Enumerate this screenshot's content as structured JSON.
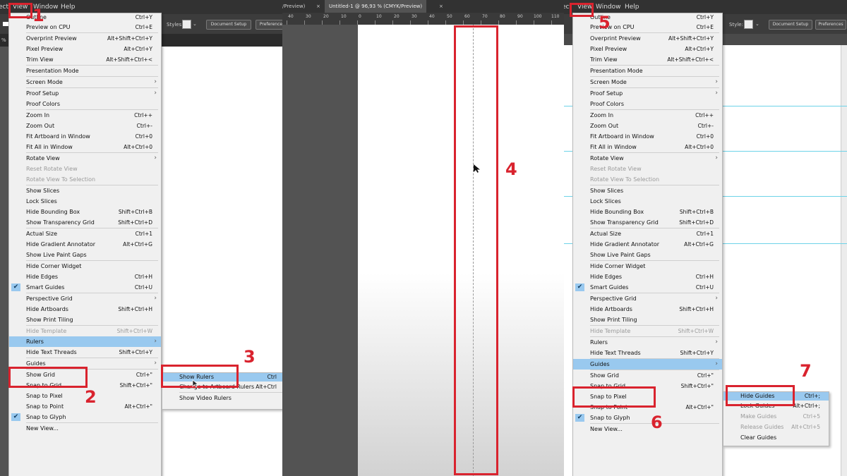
{
  "panel1": {
    "menubar": [
      "ect",
      "View",
      "Window",
      "Help"
    ],
    "control": {
      "styles_label": "Styles:",
      "document_setup": "Document Setup",
      "preferences": "Preference"
    },
    "tab_fragment": "%",
    "view_menu": [
      {
        "label": "Outline",
        "shortcut": "Ctrl+Y"
      },
      {
        "label": "Preview on CPU",
        "shortcut": "Ctrl+E"
      },
      "sep",
      {
        "label": "Overprint Preview",
        "shortcut": "Alt+Shift+Ctrl+Y"
      },
      {
        "label": "Pixel Preview",
        "shortcut": "Alt+Ctrl+Y"
      },
      {
        "label": "Trim View",
        "shortcut": "Alt+Shift+Ctrl+<"
      },
      "sep",
      {
        "label": "Presentation Mode"
      },
      "sep",
      {
        "label": "Screen Mode",
        "submenu": true
      },
      "sep",
      {
        "label": "Proof Setup",
        "submenu": true
      },
      {
        "label": "Proof Colors"
      },
      "sep",
      {
        "label": "Zoom In",
        "shortcut": "Ctrl++"
      },
      {
        "label": "Zoom Out",
        "shortcut": "Ctrl+-"
      },
      {
        "label": "Fit Artboard in Window",
        "shortcut": "Ctrl+0"
      },
      {
        "label": "Fit All in Window",
        "shortcut": "Alt+Ctrl+0"
      },
      "sep",
      {
        "label": "Rotate View",
        "submenu": true
      },
      {
        "label": "Reset Rotate View",
        "disabled": true
      },
      {
        "label": "Rotate View To Selection",
        "disabled": true
      },
      "sep",
      {
        "label": "Show Slices"
      },
      {
        "label": "Lock Slices"
      },
      {
        "label": "Hide Bounding Box",
        "shortcut": "Shift+Ctrl+B"
      },
      {
        "label": "Show Transparency Grid",
        "shortcut": "Shift+Ctrl+D"
      },
      "sep",
      {
        "label": "Actual Size",
        "shortcut": "Ctrl+1"
      },
      {
        "label": "Hide Gradient Annotator",
        "shortcut": "Alt+Ctrl+G"
      },
      {
        "label": "Show Live Paint Gaps"
      },
      "sep",
      {
        "label": "Hide Corner Widget"
      },
      {
        "label": "Hide Edges",
        "shortcut": "Ctrl+H"
      },
      {
        "label": "Smart Guides",
        "shortcut": "Ctrl+U",
        "checked": true
      },
      "sep",
      {
        "label": "Perspective Grid",
        "submenu": true
      },
      {
        "label": "Hide Artboards",
        "shortcut": "Shift+Ctrl+H"
      },
      {
        "label": "Show Print Tiling"
      },
      "sep",
      {
        "label": "Hide Template",
        "shortcut": "Shift+Ctrl+W",
        "disabled": true
      },
      {
        "label": "Rulers",
        "submenu": true,
        "highlighted": true
      },
      {
        "label": "Hide Text Threads",
        "shortcut": "Shift+Ctrl+Y"
      },
      "sep",
      {
        "label": "Guides",
        "submenu": true
      },
      "sep",
      {
        "label": "Show Grid",
        "shortcut": "Ctrl+\""
      },
      {
        "label": "Snap to Grid",
        "shortcut": "Shift+Ctrl+\""
      },
      {
        "label": "Snap to Pixel"
      },
      {
        "label": "Snap to Point",
        "shortcut": "Alt+Ctrl+\""
      },
      {
        "label": "Snap to Glyph",
        "checked": true
      },
      "sep",
      {
        "label": "New View..."
      }
    ],
    "rulers_submenu": [
      {
        "label": "Show Rulers",
        "shortcut": "Ctrl",
        "highlighted": true
      },
      {
        "label": "Change to Artboard Rulers",
        "shortcut": "Alt+Ctrl"
      },
      "sep",
      {
        "label": "Show Video Rulers"
      }
    ]
  },
  "panel2": {
    "tabs": [
      "/Preview)",
      "×",
      "Untitled-1 @ 96,93 % (CMYK/Preview)",
      "×"
    ],
    "ruler_labels": [
      "40",
      "30",
      "20",
      "10",
      "0",
      "10",
      "20",
      "30",
      "40",
      "50",
      "60",
      "70",
      "80",
      "90",
      "100",
      "110"
    ]
  },
  "panel3": {
    "menubar": [
      "ect",
      "View",
      "Window",
      "Help"
    ],
    "control": {
      "styles_label": "Style:",
      "document_setup": "Document Setup",
      "preferences": "Preferences"
    },
    "view_menu": [
      {
        "label": "Outline",
        "shortcut": "Ctrl+Y"
      },
      {
        "label": "Preview on CPU",
        "shortcut": "Ctrl+E"
      },
      "sep",
      {
        "label": "Overprint Preview",
        "shortcut": "Alt+Shift+Ctrl+Y"
      },
      {
        "label": "Pixel Preview",
        "shortcut": "Alt+Ctrl+Y"
      },
      {
        "label": "Trim View",
        "shortcut": "Alt+Shift+Ctrl+<"
      },
      "sep",
      {
        "label": "Presentation Mode"
      },
      "sep",
      {
        "label": "Screen Mode",
        "submenu": true
      },
      "sep",
      {
        "label": "Proof Setup",
        "submenu": true
      },
      {
        "label": "Proof Colors"
      },
      "sep",
      {
        "label": "Zoom In",
        "shortcut": "Ctrl++"
      },
      {
        "label": "Zoom Out",
        "shortcut": "Ctrl+-"
      },
      {
        "label": "Fit Artboard in Window",
        "shortcut": "Ctrl+0"
      },
      {
        "label": "Fit All in Window",
        "shortcut": "Alt+Ctrl+0"
      },
      "sep",
      {
        "label": "Rotate View",
        "submenu": true
      },
      {
        "label": "Reset Rotate View",
        "disabled": true
      },
      {
        "label": "Rotate View To Selection",
        "disabled": true
      },
      "sep",
      {
        "label": "Show Slices"
      },
      {
        "label": "Lock Slices"
      },
      {
        "label": "Hide Bounding Box",
        "shortcut": "Shift+Ctrl+B"
      },
      {
        "label": "Show Transparency Grid",
        "shortcut": "Shift+Ctrl+D"
      },
      "sep",
      {
        "label": "Actual Size",
        "shortcut": "Ctrl+1"
      },
      {
        "label": "Hide Gradient Annotator",
        "shortcut": "Alt+Ctrl+G"
      },
      {
        "label": "Show Live Paint Gaps"
      },
      "sep",
      {
        "label": "Hide Corner Widget"
      },
      {
        "label": "Hide Edges",
        "shortcut": "Ctrl+H"
      },
      {
        "label": "Smart Guides",
        "shortcut": "Ctrl+U",
        "checked": true
      },
      "sep",
      {
        "label": "Perspective Grid",
        "submenu": true
      },
      {
        "label": "Hide Artboards",
        "shortcut": "Shift+Ctrl+H"
      },
      {
        "label": "Show Print Tiling"
      },
      "sep",
      {
        "label": "Hide Template",
        "shortcut": "Shift+Ctrl+W",
        "disabled": true
      },
      "sep",
      {
        "label": "Rulers",
        "submenu": true
      },
      {
        "label": "Hide Text Threads",
        "shortcut": "Shift+Ctrl+Y"
      },
      "sep",
      {
        "label": "Guides",
        "submenu": true,
        "highlighted": true
      },
      "sep",
      {
        "label": "Show Grid",
        "shortcut": "Ctrl+\""
      },
      {
        "label": "Snap to Grid",
        "shortcut": "Shift+Ctrl+\""
      },
      {
        "label": "Snap to Pixel"
      },
      {
        "label": "Snap to Point",
        "shortcut": "Alt+Ctrl+\""
      },
      {
        "label": "Snap to Glyph",
        "checked": true
      },
      "sep",
      {
        "label": "New View..."
      }
    ],
    "guides_submenu": [
      {
        "label": "Hide Guides",
        "shortcut": "Ctrl+;",
        "highlighted": true
      },
      {
        "label": "Lock Guides",
        "shortcut": "Alt+Ctrl+;"
      },
      {
        "label": "Make Guides",
        "shortcut": "Ctrl+5",
        "disabled": true
      },
      {
        "label": "Release Guides",
        "shortcut": "Alt+Ctrl+5",
        "disabled": true
      },
      {
        "label": "Clear Guides"
      }
    ]
  },
  "steps": [
    "1",
    "2",
    "3",
    "4",
    "5",
    "6",
    "7"
  ],
  "colors": {
    "annotation_red": "#d9232e",
    "menu_highlight": "#99c9ef",
    "guide_cyan": "#6dd3e8"
  }
}
